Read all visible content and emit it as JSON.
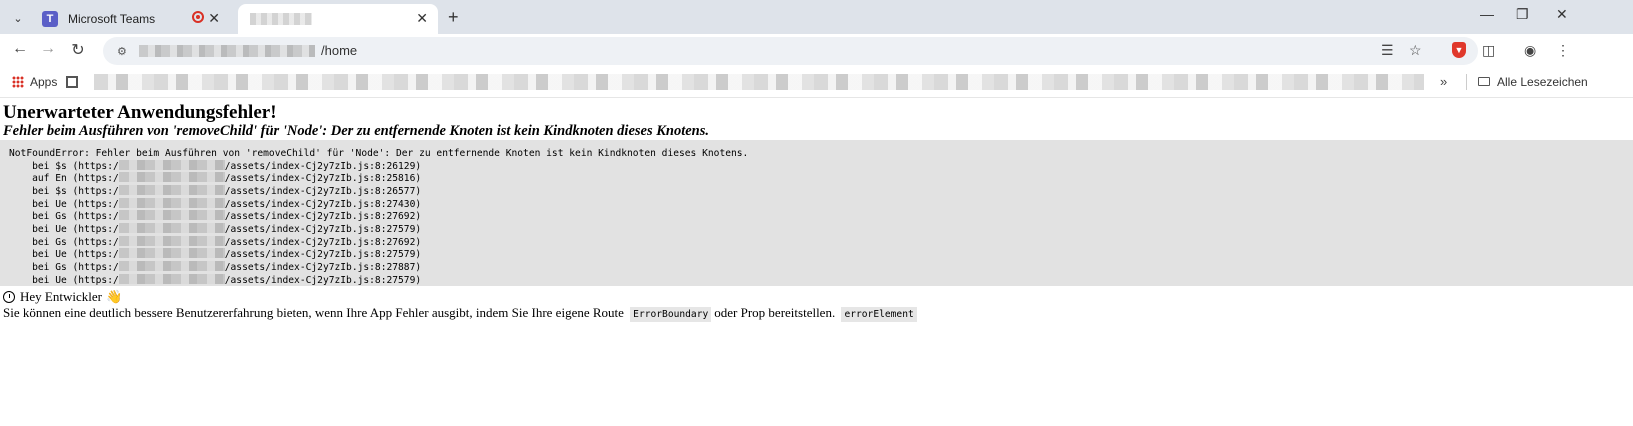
{
  "browser": {
    "tabs": [
      {
        "title": "Microsoft Teams",
        "icon": "teams-icon",
        "recording": true
      },
      {
        "title": "",
        "active": true
      }
    ],
    "url_path": "/home"
  },
  "bookmarks": {
    "apps_label": "Apps",
    "all_bookmarks_label": "Alle Lesezeichen"
  },
  "error": {
    "title": "Unerwarteter Anwendungsfehler!",
    "message": "Fehler beim Ausführen von 'removeChild' für 'Node': Der zu entfernende Knoten ist kein Kindknoten dieses Knotens.",
    "stack_header": "NotFoundError: Fehler beim Ausführen von 'removeChild' für 'Node': Der zu entfernende Knoten ist kein Kindknoten dieses Knotens.",
    "stack": [
      {
        "prefix": "    bei $s (https:/",
        "suffix": "/assets/index-Cj2y7zIb.js:8:26129)"
      },
      {
        "prefix": "    auf En (https:/",
        "suffix": "/assets/index-Cj2y7zIb.js:8:25816)"
      },
      {
        "prefix": "    bei $s (https:/",
        "suffix": "/assets/index-Cj2y7zIb.js:8:26577)"
      },
      {
        "prefix": "    bei Ue (https:/",
        "suffix": "/assets/index-Cj2y7zIb.js:8:27430)"
      },
      {
        "prefix": "    bei Gs (https:/",
        "suffix": "/assets/index-Cj2y7zIb.js:8:27692)"
      },
      {
        "prefix": "    bei Ue (https:/",
        "suffix": "/assets/index-Cj2y7zIb.js:8:27579)"
      },
      {
        "prefix": "    bei Gs (https:/",
        "suffix": "/assets/index-Cj2y7zIb.js:8:27692)"
      },
      {
        "prefix": "    bei Ue (https:/",
        "suffix": "/assets/index-Cj2y7zIb.js:8:27579)"
      },
      {
        "prefix": "    bei Gs (https:/",
        "suffix": "/assets/index-Cj2y7zIb.js:8:27887)"
      },
      {
        "prefix": "    bei Ue (https:/",
        "suffix": "/assets/index-Cj2y7zIb.js:8:27579)"
      }
    ]
  },
  "hint": {
    "heading": "Hey Entwickler",
    "text_before": "Sie können eine deutlich bessere Benutzererfahrung bieten, wenn Ihre App Fehler ausgibt, indem Sie Ihre eigene Route",
    "code1": "ErrorBoundary",
    "text_middle": "oder Prop bereitstellen.",
    "code2": "errorElement"
  }
}
